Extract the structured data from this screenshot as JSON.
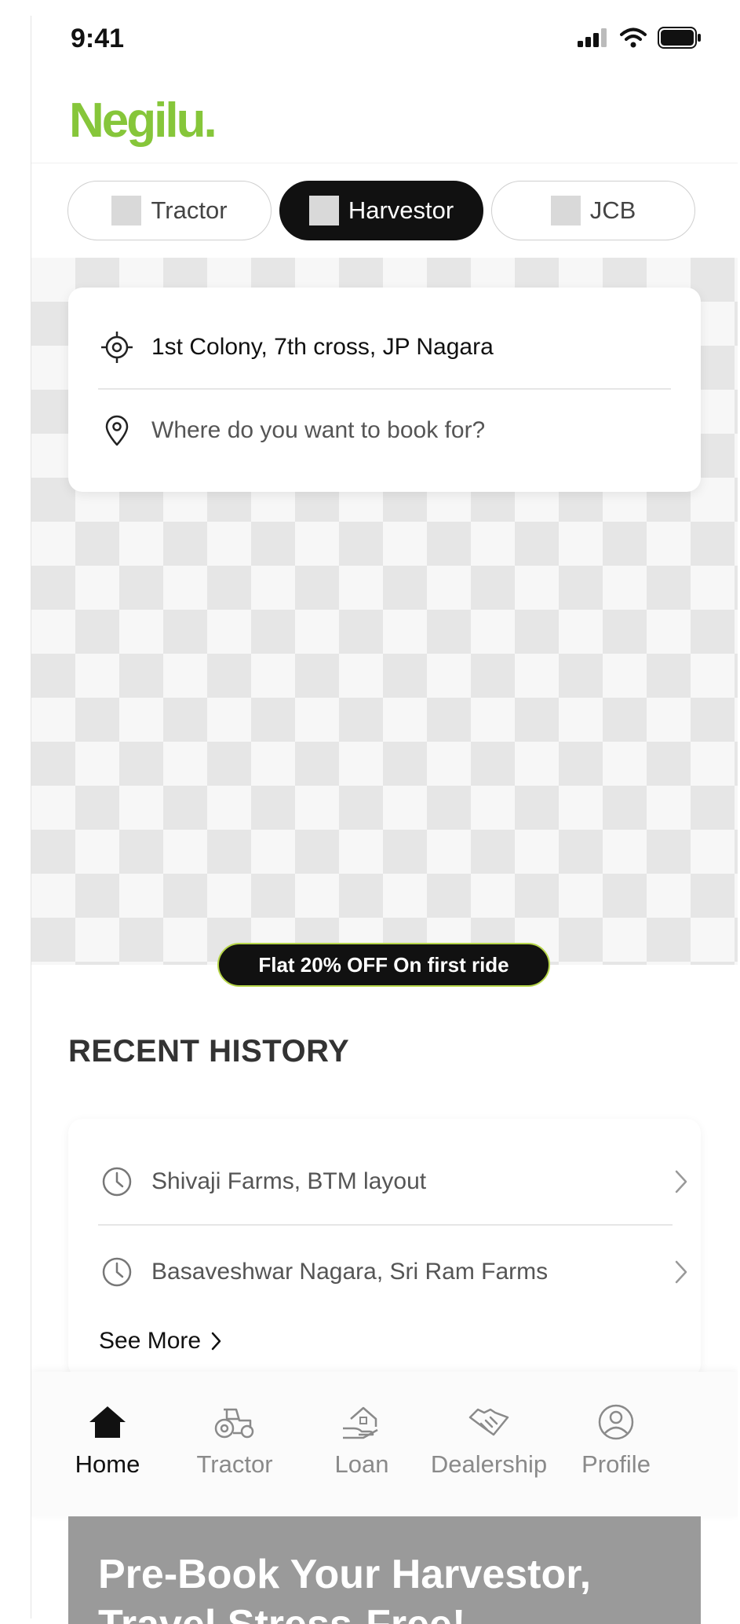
{
  "status_bar": {
    "time": "9:41"
  },
  "header": {
    "logo": "Negilu."
  },
  "vehicle_tabs": [
    {
      "label": "Tractor",
      "active": false
    },
    {
      "label": "Harvestor",
      "active": true
    },
    {
      "label": "JCB",
      "active": false
    }
  ],
  "location": {
    "from": "1st Colony, 7th cross, JP Nagara",
    "to_placeholder": "Where do you want to book for?"
  },
  "promo": {
    "label": "Flat 20% OFF On first ride"
  },
  "recent_history": {
    "title": "RECENT HISTORY",
    "items": [
      {
        "label": "Shivaji Farms, BTM layout"
      },
      {
        "label": "Basaveshwar Nagara, Sri Ram Farms"
      }
    ],
    "see_more": "See More"
  },
  "bottom_nav": [
    {
      "label": "Home",
      "icon": "home-icon",
      "active": true
    },
    {
      "label": "Tractor",
      "icon": "tractor-icon",
      "active": false
    },
    {
      "label": "Loan",
      "icon": "loan-icon",
      "active": false
    },
    {
      "label": "Dealership",
      "icon": "handshake-icon",
      "active": false
    },
    {
      "label": "Profile",
      "icon": "profile-icon",
      "active": false
    }
  ],
  "banner": {
    "title": "Pre-Book Your Harvestor, Travel Stress-Free!"
  },
  "colors": {
    "brand": "#86c63a",
    "active_chip": "#111111",
    "promo_border": "#b7d64a"
  }
}
